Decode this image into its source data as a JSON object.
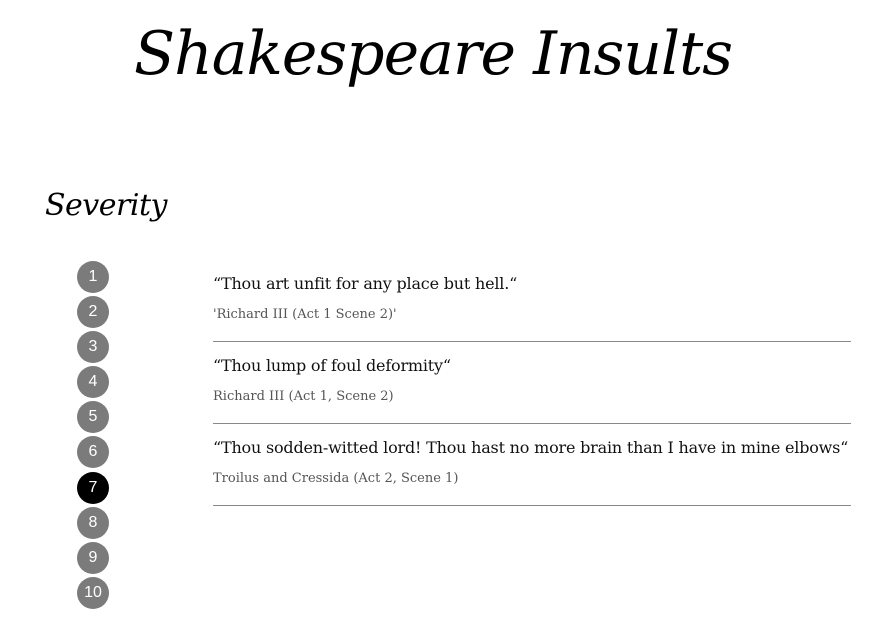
{
  "header": {
    "title": "Shakespeare Insults"
  },
  "severity": {
    "heading": "Severity",
    "levels": [
      "1",
      "2",
      "3",
      "4",
      "5",
      "6",
      "7",
      "8",
      "9",
      "10"
    ],
    "selected": "7"
  },
  "quotes": [
    {
      "text": "“Thou art unfit for any place but hell.“",
      "source": "'Richard III (Act 1 Scene 2)'"
    },
    {
      "text": "“Thou lump of foul deformity“",
      "source": "Richard III (Act 1, Scene 2)"
    },
    {
      "text": "“Thou sodden-witted lord! Thou hast no more brain than I have in mine elbows“",
      "source": "Troilus and Cressida (Act 2, Scene 1)"
    }
  ],
  "colors": {
    "severity_default": "#7b7b7b",
    "severity_selected": "#000000",
    "divider": "#888888",
    "source_text": "#555555"
  }
}
